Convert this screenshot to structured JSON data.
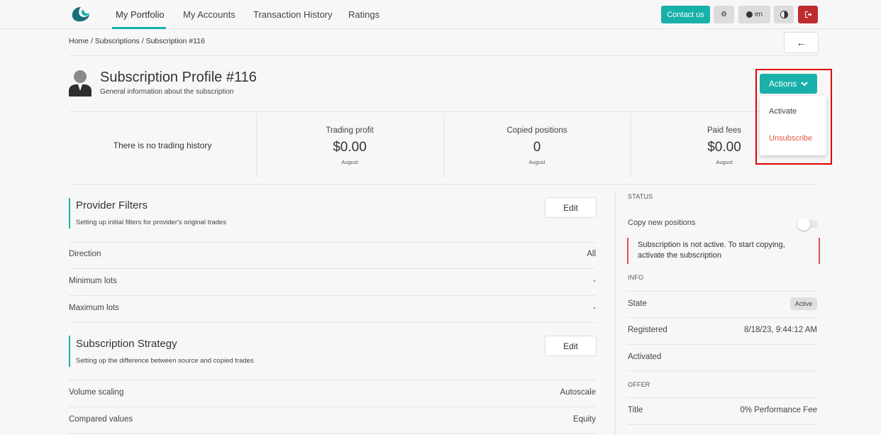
{
  "nav": {
    "items": [
      {
        "label": "My Portfolio"
      },
      {
        "label": "My Accounts"
      },
      {
        "label": "Transaction History"
      },
      {
        "label": "Ratings"
      }
    ],
    "contact_label": "Contact us",
    "lang_label": "en"
  },
  "breadcrumb": {
    "home": "Home",
    "sep1": "/",
    "subscriptions": "Subscriptions",
    "sep2": "/",
    "current": "Subscription #116"
  },
  "header": {
    "title": "Subscription Profile #116",
    "subtitle": "General information about the subscription",
    "actions_label": "Actions",
    "actions_menu": [
      {
        "label": "Activate"
      },
      {
        "label": "Unsubscribe"
      }
    ]
  },
  "stats": {
    "no_history": "There is no trading history",
    "items": [
      {
        "label": "Trading profit",
        "value": "$0.00",
        "period": "August"
      },
      {
        "label": "Copied positions",
        "value": "0",
        "period": "August"
      },
      {
        "label": "Paid fees",
        "value": "$0.00",
        "period": "August"
      }
    ]
  },
  "provider_filters": {
    "title": "Provider Filters",
    "desc": "Setting up initial filters for provider's original trades",
    "edit_label": "Edit",
    "rows": [
      {
        "label": "Direction",
        "value": "All"
      },
      {
        "label": "Minimum lots",
        "value": "-"
      },
      {
        "label": "Maximum lots",
        "value": "-"
      }
    ]
  },
  "strategy": {
    "title": "Subscription Strategy",
    "desc": "Setting up the difference between source and copied trades",
    "edit_label": "Edit",
    "rows": [
      {
        "label": "Volume scaling",
        "value": "Autoscale"
      },
      {
        "label": "Compared values",
        "value": "Equity"
      }
    ]
  },
  "sidebar": {
    "status_heading": "STATUS",
    "copy_label": "Copy new positions",
    "alert": "Subscription is not active. To start copying, activate the subscription",
    "info_heading": "INFO",
    "state_label": "State",
    "state_value": "Active",
    "registered_label": "Registered",
    "registered_value": "8/18/23, 9:44:12 AM",
    "activated_label": "Activated",
    "offer_heading": "OFFER",
    "offer_title_label": "Title",
    "offer_title_value": "0% Performance Fee"
  },
  "colors": {
    "accent": "#19b0aa",
    "danger": "#bd2d2d",
    "highlight": "#e00000",
    "unsubscribe": "#e4553e"
  }
}
